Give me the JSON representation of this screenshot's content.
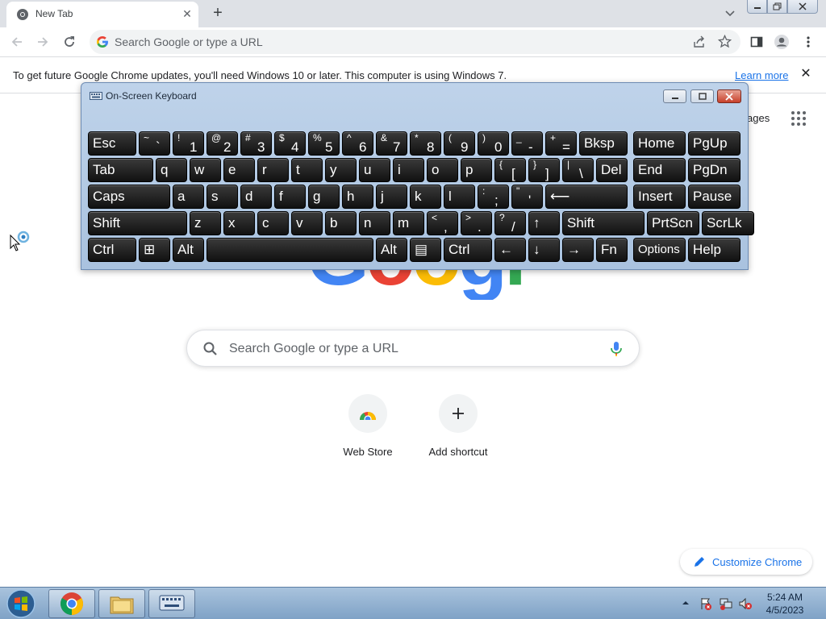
{
  "browser": {
    "tab": {
      "title": "New Tab"
    },
    "omnibox": {
      "placeholder": "Search Google or type a URL"
    }
  },
  "infobar": {
    "message": "To get future Google Chrome updates, you'll need Windows 10 or later. This computer is using Windows 7.",
    "link": "Learn more"
  },
  "page": {
    "images_link": "ages",
    "logo_letters": [
      "G",
      "o",
      "o",
      "g",
      "l",
      "e"
    ],
    "search_placeholder": "Search Google or type a URL",
    "shortcuts": [
      {
        "label": "Web Store",
        "icon": "web-store-icon"
      },
      {
        "label": "Add shortcut",
        "icon": "plus-icon"
      }
    ],
    "customize_label": "Customize Chrome"
  },
  "osk": {
    "title": "On-Screen Keyboard",
    "rows": [
      [
        {
          "t": "Esc"
        },
        {
          "u": "~",
          "d": "`"
        },
        {
          "u": "!",
          "d": "1"
        },
        {
          "u": "@",
          "d": "2"
        },
        {
          "u": "#",
          "d": "3"
        },
        {
          "u": "$",
          "d": "4"
        },
        {
          "u": "%",
          "d": "5"
        },
        {
          "u": "^",
          "d": "6"
        },
        {
          "u": "&",
          "d": "7"
        },
        {
          "u": "*",
          "d": "8"
        },
        {
          "u": "(",
          "d": "9"
        },
        {
          "u": ")",
          "d": "0"
        },
        {
          "u": "_",
          "d": "-"
        },
        {
          "u": "+",
          "d": "="
        },
        {
          "t": "Bksp"
        },
        {
          "t": "Home"
        },
        {
          "t": "PgUp"
        }
      ],
      [
        {
          "t": "Tab"
        },
        {
          "t": "q"
        },
        {
          "t": "w"
        },
        {
          "t": "e"
        },
        {
          "t": "r"
        },
        {
          "t": "t"
        },
        {
          "t": "y"
        },
        {
          "t": "u"
        },
        {
          "t": "i"
        },
        {
          "t": "o"
        },
        {
          "t": "p"
        },
        {
          "u": "{",
          "d": "["
        },
        {
          "u": "}",
          "d": "]"
        },
        {
          "u": "|",
          "d": "\\"
        },
        {
          "t": "Del"
        },
        {
          "t": "End"
        },
        {
          "t": "PgDn"
        }
      ],
      [
        {
          "t": "Caps"
        },
        {
          "t": "a"
        },
        {
          "t": "s"
        },
        {
          "t": "d"
        },
        {
          "t": "f"
        },
        {
          "t": "g"
        },
        {
          "t": "h"
        },
        {
          "t": "j"
        },
        {
          "t": "k"
        },
        {
          "t": "l"
        },
        {
          "u": ":",
          "d": ";"
        },
        {
          "u": "\"",
          "d": "'"
        },
        {
          "t": "⟵"
        },
        {
          "t": "Insert"
        },
        {
          "t": "Pause"
        }
      ],
      [
        {
          "t": "Shift"
        },
        {
          "t": "z"
        },
        {
          "t": "x"
        },
        {
          "t": "c"
        },
        {
          "t": "v"
        },
        {
          "t": "b"
        },
        {
          "t": "n"
        },
        {
          "t": "m"
        },
        {
          "u": "<",
          "d": ","
        },
        {
          "u": ">",
          "d": "."
        },
        {
          "u": "?",
          "d": "/"
        },
        {
          "t": "↑"
        },
        {
          "t": "Shift"
        },
        {
          "t": "PrtScn"
        },
        {
          "t": "ScrLk"
        }
      ],
      [
        {
          "t": "Ctrl"
        },
        {
          "t": "⊞"
        },
        {
          "t": "Alt"
        },
        {
          "t": ""
        },
        {
          "t": "Alt"
        },
        {
          "t": "▤"
        },
        {
          "t": "Ctrl"
        },
        {
          "t": "←"
        },
        {
          "t": "↓"
        },
        {
          "t": "→"
        },
        {
          "t": "Fn"
        },
        {
          "t": "Options"
        },
        {
          "t": "Help"
        }
      ]
    ]
  },
  "taskbar": {
    "apps": [
      "chrome-icon",
      "explorer-icon",
      "keyboard-icon"
    ],
    "time": "5:24 AM",
    "date": "4/5/2023"
  },
  "colors": {
    "google_blue": "#4285f4",
    "google_red": "#ea4335",
    "google_yellow": "#fbbc05",
    "google_green": "#34a853",
    "link": "#1a73e8"
  }
}
